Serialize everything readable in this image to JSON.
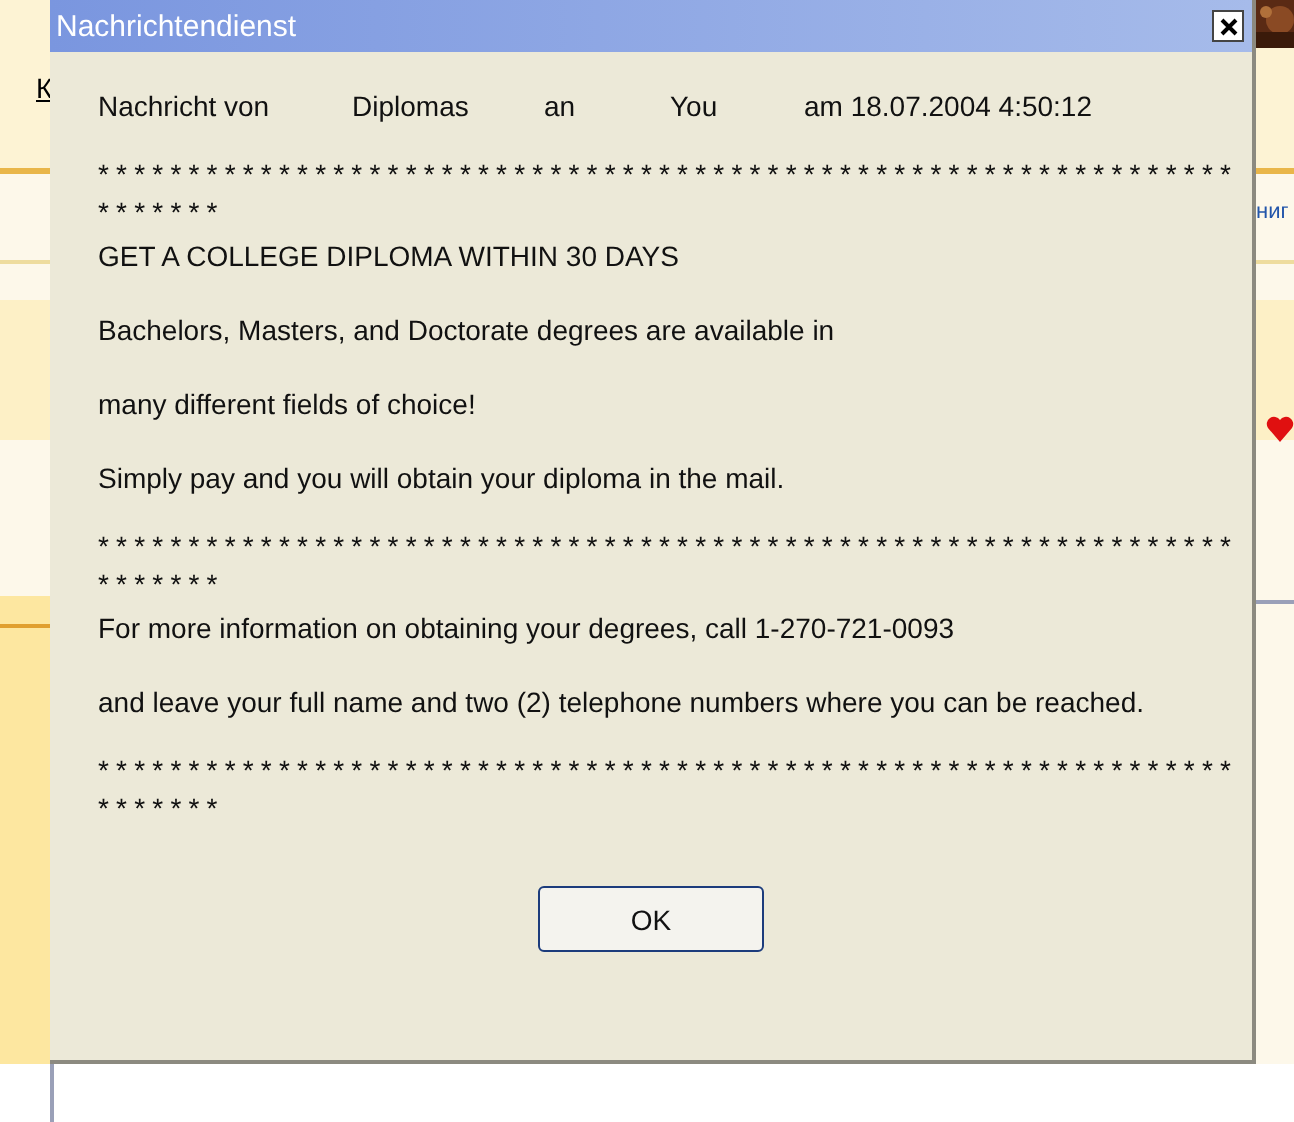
{
  "background": {
    "link": "К",
    "text": "ниг"
  },
  "window": {
    "title": "Nachrichtendienst"
  },
  "header": [
    "Nachricht von",
    "Diplomas",
    "an",
    "You",
    "am 18.07.2004 4:50:12"
  ],
  "body": [
    {
      "kind": "rule",
      "text": "**********************************************************************"
    },
    {
      "kind": "line",
      "text": "GET A COLLEGE DIPLOMA WITHIN 30 DAYS"
    },
    {
      "kind": "line",
      "text": "Bachelors, Masters, and Doctorate degrees are available in"
    },
    {
      "kind": "line",
      "text": "many different fields of choice!"
    },
    {
      "kind": "line",
      "text": "Simply pay and you will obtain your diploma in the mail."
    },
    {
      "kind": "rule",
      "text": "**********************************************************************"
    },
    {
      "kind": "line",
      "text": "For more information on obtaining your degrees, call 1-270-721-0093"
    },
    {
      "kind": "line",
      "text": "and leave your full name and two (2) telephone numbers where you can be reached."
    },
    {
      "kind": "rule",
      "text": "**********************************************************************"
    }
  ],
  "buttons": [
    "OK"
  ]
}
